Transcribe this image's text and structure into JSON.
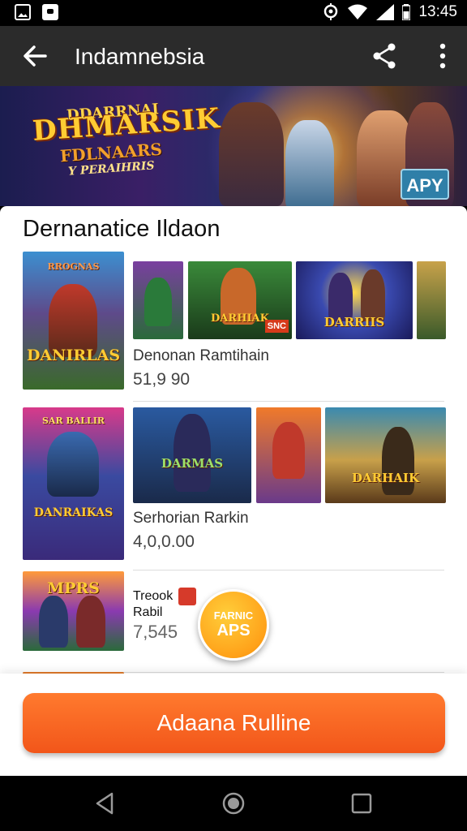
{
  "status_bar": {
    "time": "13:45",
    "icons": [
      "image-icon",
      "message-icon",
      "location-icon",
      "wifi-icon",
      "signal-icon",
      "battery-icon"
    ]
  },
  "app_bar": {
    "title": "Indamnebsia",
    "back_icon": "arrow-left-icon",
    "share_icon": "share-icon",
    "menu_icon": "more-vert-icon"
  },
  "banner": {
    "logo_top": "DDARRNAI",
    "logo_main": "DHMARSIK",
    "logo_sub1": "FDLNAARS",
    "logo_sub2": "Y PERAIHRIS",
    "badge": "APY"
  },
  "section": {
    "heading": "Dernanatice Ildaon"
  },
  "items": [
    {
      "label": "Denonan Ramtihain",
      "price": "51,9 90",
      "cover_caption": "DANIRLAS",
      "cover_top": "RROGNAS",
      "thumb_captions": [
        "",
        "DARHIAK",
        "DARRIIS",
        ""
      ],
      "thumb_badge": "SNC"
    },
    {
      "label": "Serhorian Rarkin",
      "price": "4,0,0.00",
      "cover_caption": "DANRAIKAS",
      "cover_top": "SAR BALLIR",
      "thumb_captions": [
        "DARMAS",
        "",
        "DARHAIK"
      ]
    },
    {
      "label_line1": "Treook",
      "label_line2": "Rabil",
      "price": "7,545",
      "cover_caption": "MPRS"
    }
  ],
  "fab": {
    "line1": "FARNIC",
    "line2": "APS"
  },
  "cta": {
    "label": "Adaana Rulline"
  },
  "nav_bar": {
    "icons": [
      "back-triangle-icon",
      "home-circle-icon",
      "recents-square-icon"
    ]
  },
  "colors": {
    "accent": "#f2561a",
    "app_bar": "#2b2b2b",
    "fab": "#ffa21a"
  }
}
